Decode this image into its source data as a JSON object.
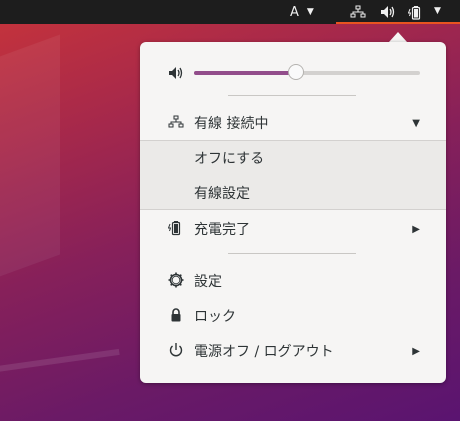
{
  "topbar": {
    "input_source": "A",
    "input_source_arrow": "▼",
    "system_arrow": "▼",
    "accent_color": "#e95420"
  },
  "volume": {
    "icon": "speaker-icon",
    "level": 0.45
  },
  "network": {
    "icon": "wired-network-icon",
    "label": "有線 接続中",
    "expand_arrow": "▼",
    "submenu": [
      {
        "label": "オフにする"
      },
      {
        "label": "有線設定"
      }
    ]
  },
  "battery": {
    "icon": "battery-charging-icon",
    "label": "充電完了",
    "expand_arrow": "▶"
  },
  "settings": {
    "icon": "gear-icon",
    "label": "設定"
  },
  "lock": {
    "icon": "lock-icon",
    "label": "ロック"
  },
  "power": {
    "icon": "power-icon",
    "label": "電源オフ / ログアウト",
    "expand_arrow": "▶"
  },
  "colors": {
    "slider_fill": "#924d8b",
    "menu_bg": "#f6f5f4",
    "topbar_bg": "#1d1d1d"
  }
}
